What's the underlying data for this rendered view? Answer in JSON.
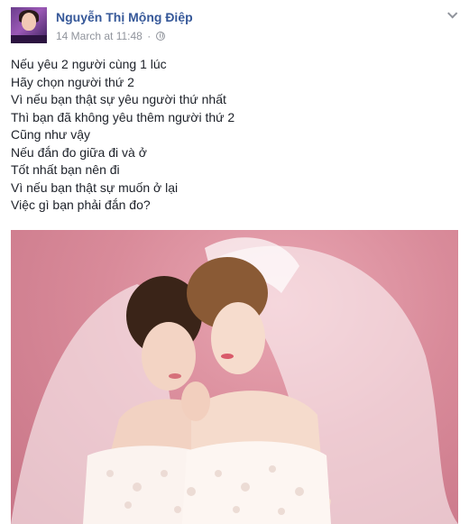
{
  "post": {
    "author": "Nguyễn Thị Mộng Điệp",
    "timestamp": "14 March at 11:48",
    "separator": "·",
    "privacy_icon": "globe-icon",
    "menu_icon": "chevron-down-icon",
    "lines": [
      "Nếu yêu 2 người cùng 1 lúc",
      "Hãy chọn người thứ 2",
      "Vì nếu bạn thật sự yêu người thứ nhất",
      "Thì bạn đã không yêu thêm người thứ 2",
      "Cũng như vậy",
      "Nếu đắn đo giữa đi và ở",
      "Tốt nhất bạn nên đi",
      "Vì nếu bạn thật sự muốn ở lại",
      "Việc gì bạn phải đắn đo?"
    ],
    "photo_subject": "two brides in white veils on pink background"
  },
  "colors": {
    "author_link": "#365899",
    "meta_text": "#90949c",
    "body_text": "#1d2129",
    "photo_background": "#d98b9a"
  }
}
